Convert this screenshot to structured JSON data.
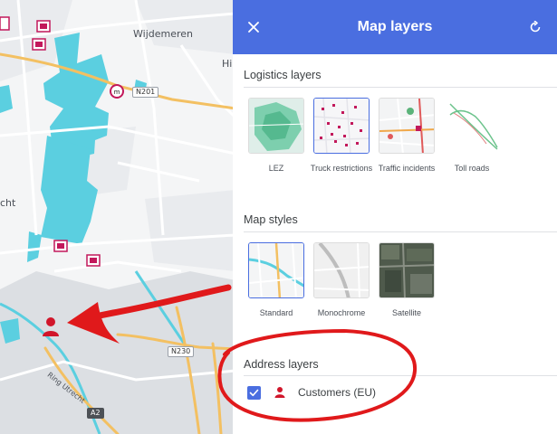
{
  "map": {
    "place_wijdemeren": "Wijdemeren",
    "place_edge_right": "Hi",
    "place_edge_left": "cht",
    "road_n201": "N201",
    "road_n230": "N230",
    "road_a2": "A2",
    "road_ring": "Ring Utrecht",
    "colors": {
      "lez": "#5bcfe0",
      "road_major": "#f3c062",
      "annotation": "#e0191b",
      "marker": "#d1162b"
    }
  },
  "panel": {
    "title": "Map layers",
    "close_icon": "close-icon",
    "refresh_icon": "refresh-icon",
    "header_color": "#4a6ee0",
    "logistics": {
      "title": "Logistics layers",
      "tiles": [
        {
          "label": "LEZ",
          "selected": false
        },
        {
          "label": "Truck restrictions",
          "selected": true
        },
        {
          "label": "Traffic incidents",
          "selected": false
        },
        {
          "label": "Toll roads",
          "selected": false
        }
      ]
    },
    "styles": {
      "title": "Map styles",
      "tiles": [
        {
          "label": "Standard",
          "selected": true
        },
        {
          "label": "Monochrome",
          "selected": false
        },
        {
          "label": "Satellite",
          "selected": false
        }
      ]
    },
    "address": {
      "title": "Address layers",
      "items": [
        {
          "label": "Customers (EU)",
          "checked": true,
          "icon": "person-pin-icon"
        }
      ]
    }
  }
}
